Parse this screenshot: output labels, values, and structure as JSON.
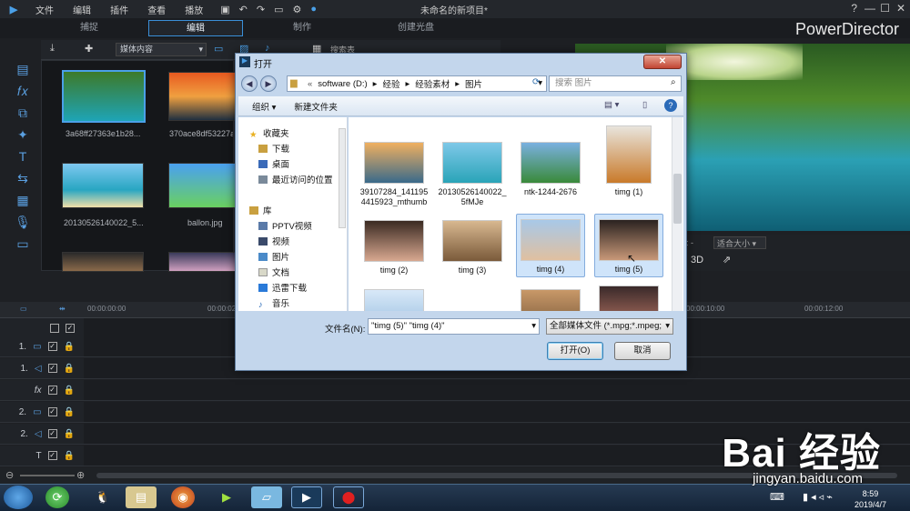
{
  "app": {
    "window_title": "未命名的新项目*",
    "brand": "PowerDirector",
    "menu": [
      "文件",
      "编辑",
      "插件",
      "查看",
      "播放"
    ],
    "help": "?",
    "minimize": "—",
    "maximize": "☐",
    "close": "✕"
  },
  "modes": {
    "capture": "捕捉",
    "edit": "编辑",
    "produce": "制作",
    "disc": "创建光盘"
  },
  "media": {
    "filter": "媒体内容",
    "search_placeholder": "搜索表",
    "items": [
      {
        "label": "3a68ff27363e1b28..."
      },
      {
        "label": "370ace8df53227a..."
      },
      {
        "label": "20130526140022_5..."
      },
      {
        "label": "ballon.jpg"
      }
    ]
  },
  "preview": {
    "fit_label": "适合大小",
    "mode_3d": "3D",
    "time": ": -"
  },
  "timeline": {
    "ticks": [
      "00:00:00:00",
      "00:00:02:",
      "00:00:10:00",
      "00:00:12:00"
    ],
    "tracks": [
      {
        "label": "1.",
        "kind": "video"
      },
      {
        "label": "1.",
        "kind": "audio"
      },
      {
        "label": "fx",
        "kind": "fx"
      },
      {
        "label": "2.",
        "kind": "video"
      },
      {
        "label": "2.",
        "kind": "audio"
      },
      {
        "label": "T",
        "kind": "title"
      }
    ]
  },
  "dialog": {
    "title": "打开",
    "close": "✕",
    "path": [
      "software (D:)",
      "经验",
      "经验素材",
      "图片"
    ],
    "search_placeholder": "搜索 图片",
    "organize": "组织 ▾",
    "new_folder": "新建文件夹",
    "nav": [
      {
        "label": "收藏夹",
        "indent": 0
      },
      {
        "label": "下载",
        "indent": 1
      },
      {
        "label": "桌面",
        "indent": 1
      },
      {
        "label": "最近访问的位置",
        "indent": 1
      },
      {
        "label": "库",
        "indent": 0
      },
      {
        "label": "PPTV视频",
        "indent": 1
      },
      {
        "label": "视频",
        "indent": 1
      },
      {
        "label": "图片",
        "indent": 1
      },
      {
        "label": "文档",
        "indent": 1
      },
      {
        "label": "迅雷下载",
        "indent": 1
      },
      {
        "label": "音乐",
        "indent": 1
      }
    ],
    "files": [
      {
        "name": "39107284_1411954415923_mthumb",
        "selected": false,
        "colors": [
          "#f0b060",
          "#3a6a8a"
        ]
      },
      {
        "name": "20130526140022_5fMJe",
        "selected": false,
        "colors": [
          "#7ec8e8",
          "#2aa4b8"
        ]
      },
      {
        "name": "ntk-1244-2676",
        "selected": false,
        "colors": [
          "#7ab0e0",
          "#3a8a3a"
        ]
      },
      {
        "name": "timg (1)",
        "selected": false,
        "colors": [
          "#e8e4dc",
          "#c97a2a"
        ]
      },
      {
        "name": "timg (2)",
        "selected": false,
        "colors": [
          "#3a2a22",
          "#d8a890"
        ]
      },
      {
        "name": "timg (3)",
        "selected": false,
        "colors": [
          "#d8b890",
          "#7a5a3a"
        ]
      },
      {
        "name": "timg (4)",
        "selected": true,
        "colors": [
          "#a8c8e8",
          "#e0c0a0"
        ]
      },
      {
        "name": "timg (5)",
        "selected": true,
        "colors": [
          "#2a2220",
          "#c89878"
        ]
      }
    ],
    "filename_label": "文件名(N):",
    "filename_value": "\"timg (5)\" \"timg (4)\"",
    "filetype": "全部媒体文件 (*.mpg;*.mpeg;",
    "open_button": "打开(O)",
    "cancel_button": "取消"
  },
  "taskbar": {
    "time": "8:59",
    "date": "2019/4/7"
  },
  "watermark": {
    "logo": "Bai 经验",
    "url": "jingyan.baidu.com"
  }
}
